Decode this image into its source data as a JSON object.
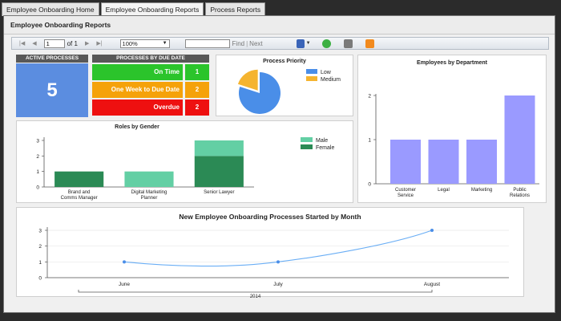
{
  "tabs": [
    {
      "label": "Employee Onboarding Home"
    },
    {
      "label": "Employee Onboarding Reports"
    },
    {
      "label": "Process Reports"
    }
  ],
  "frame": {
    "title": "Employee Onboarding Reports"
  },
  "toolbar": {
    "page_value": "1",
    "of_label": "of 1",
    "zoom_value": "100%",
    "find_label": "Find",
    "next_label": "Next",
    "find_value": ""
  },
  "kpi": {
    "active_header": "ACTIVE PROCESSES",
    "active_value": "5",
    "due_header": "PROCESSES BY DUE DATE",
    "rows": [
      {
        "label": "On Time",
        "count": "1",
        "color": "#2bc42b"
      },
      {
        "label": "One Week to Due Date",
        "count": "2",
        "color": "#f5a20a"
      },
      {
        "label": "Overdue",
        "count": "2",
        "color": "#ee1010"
      }
    ]
  },
  "colors": {
    "low": "#4a8ee8",
    "medium": "#f5b42f",
    "male": "#63cfa4",
    "female": "#2b8a55",
    "dept": "#9a9aff",
    "line": "#6aaef5"
  },
  "chart_data": [
    {
      "type": "pie",
      "title": "Process Priority",
      "series": [
        {
          "name": "Low",
          "value": 4
        },
        {
          "name": "Medium",
          "value": 1
        }
      ],
      "legend": "right"
    },
    {
      "type": "bar",
      "title": "Employees by Department",
      "categories": [
        "Customer Service",
        "Legal",
        "Marketing",
        "Public Relations"
      ],
      "values": [
        1,
        1,
        1,
        2
      ],
      "ylim": [
        0,
        2
      ],
      "yticks": [
        0,
        1,
        2
      ]
    },
    {
      "type": "bar",
      "stacked": true,
      "title": "Roles by Gender",
      "categories": [
        "Brand and Comms Manager",
        "Digital Marketing Planner",
        "Senior Lawyer"
      ],
      "series": [
        {
          "name": "Male",
          "values": [
            0,
            1,
            1
          ]
        },
        {
          "name": "Female",
          "values": [
            1,
            0,
            2
          ]
        }
      ],
      "ylim": [
        0,
        3
      ],
      "yticks": [
        0,
        1,
        2,
        3
      ],
      "legend": "top-right"
    },
    {
      "type": "line",
      "title": "New Employee Onboarding Processes Started by Month",
      "categories": [
        "June",
        "July",
        "August"
      ],
      "values": [
        1,
        1,
        3
      ],
      "group_label": "2014",
      "ylim": [
        0,
        3
      ],
      "yticks": [
        0,
        1,
        2,
        3
      ]
    }
  ]
}
